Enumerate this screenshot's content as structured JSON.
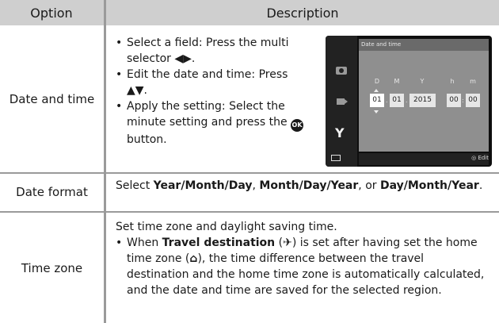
{
  "header": {
    "option": "Option",
    "description": "Description"
  },
  "rows": [
    {
      "option": "Date and time",
      "bullets": [
        {
          "pre": "Select a field: Press the multi selector ",
          "sym": "◀▶",
          "post": "."
        },
        {
          "pre": "Edit the date and time: Press ",
          "sym": "▲▼",
          "post": "."
        },
        {
          "pre": "Apply the setting: Select the minute setting and press the ",
          "sym": "OK",
          "post": " button."
        }
      ],
      "screen": {
        "title": "Date and time",
        "labels": [
          "D",
          "M",
          "Y",
          "h",
          "m"
        ],
        "day": "01",
        "month": "01",
        "year": "2015",
        "hour": "00",
        "minute": "00",
        "footer": "Edit",
        "icons": [
          "camera-icon",
          "movie-icon",
          "wrench-icon",
          "battery-icon"
        ]
      }
    },
    {
      "option": "Date format",
      "pre": "Select ",
      "f1": "Year/Month/Day",
      "sep1": ", ",
      "f2": "Month/Day/Year",
      "sep2": ", or ",
      "f3": "Day/Month/Year",
      "end": "."
    },
    {
      "option": "Time zone",
      "intro": "Set time zone and daylight saving time.",
      "b_pre": "When ",
      "b_bold": "Travel destination",
      "b_mid1": " (",
      "b_sym1": "✈",
      "b_mid2": ") is set after having set the home time zone (",
      "b_sym2": "⌂",
      "b_post": "), the time difference between the travel destination and the home time zone is automatically calculated, and the date and time are saved for the selected region."
    }
  ]
}
